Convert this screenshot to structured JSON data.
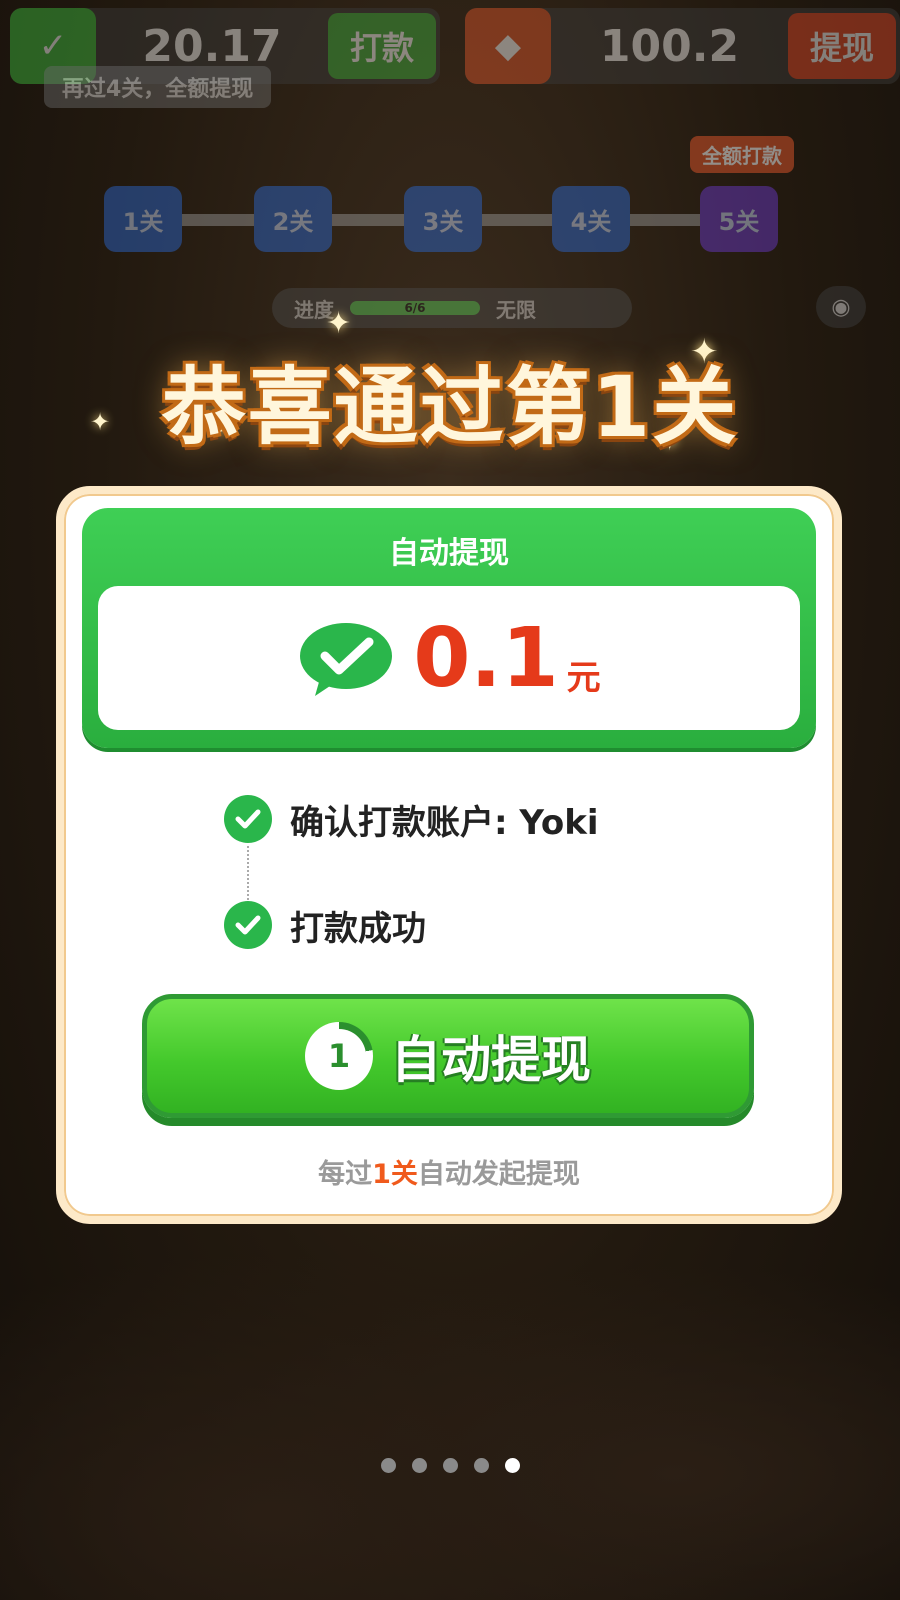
{
  "background": {
    "wechat_balance": "20.17",
    "wechat_action": "打款",
    "cash_balance": "100.2",
    "cash_action": "提现",
    "hint": "再过4关，全额提现",
    "full_tag": "全额打款",
    "levels": [
      "1关",
      "2关",
      "3关",
      "4关",
      "5关"
    ],
    "progress_label": "进度",
    "progress_value": "6/6",
    "unlimited_label": "无限"
  },
  "celebration_title": "恭喜通过第1关",
  "card": {
    "panel_title": "自动提现",
    "amount": "0.1",
    "unit": "元",
    "steps": [
      {
        "label": "确认打款账户: Yoki"
      },
      {
        "label": "打款成功"
      }
    ],
    "button_countdown": "1",
    "button_label": "自动提现",
    "footnote_prefix": "每过",
    "footnote_highlight": "1关",
    "footnote_suffix": "自动发起提现"
  },
  "pager": {
    "count": 5,
    "active_index": 4
  },
  "colors": {
    "accent_green": "#2ab64b",
    "amount_red": "#e53a1a",
    "highlight_orange": "#f05a1c"
  },
  "icons": [
    "wechat-pay-icon",
    "check-icon",
    "sparkle-icon",
    "countdown-ring-icon",
    "camera-icon"
  ]
}
